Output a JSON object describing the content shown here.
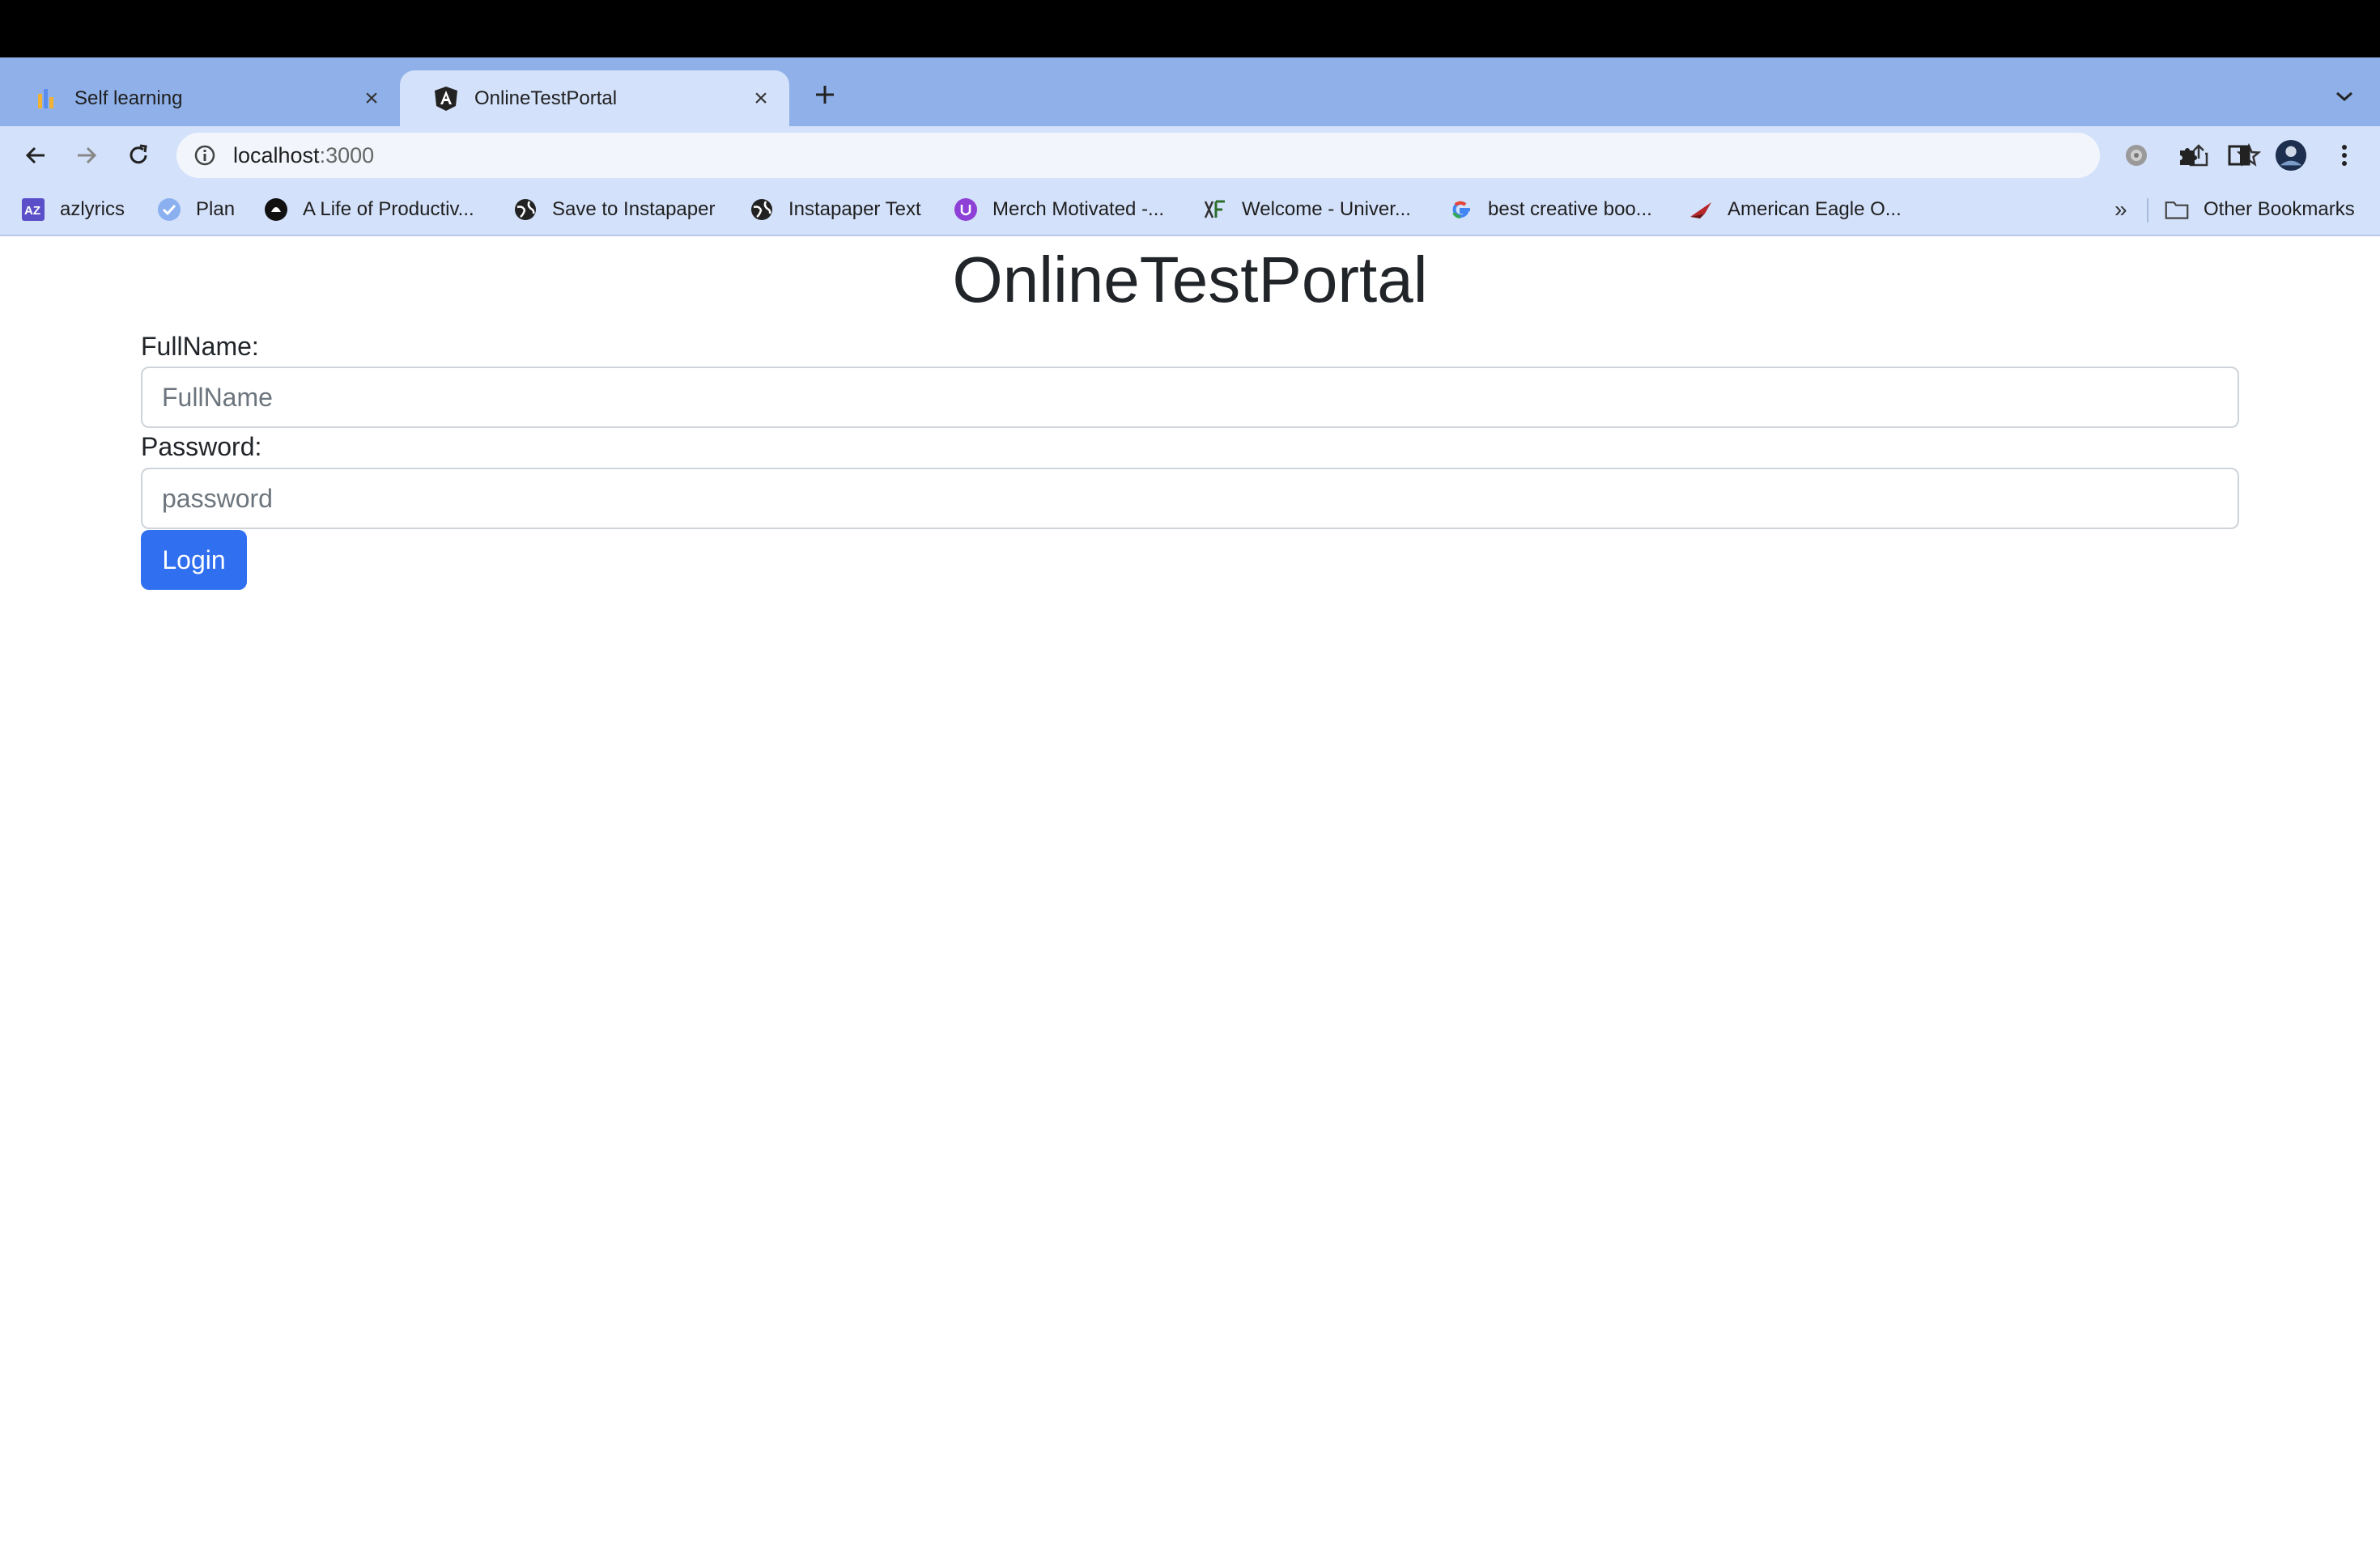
{
  "browser": {
    "tabs": [
      {
        "title": "Self learning",
        "active": false,
        "icon": "bar-chart-icon"
      },
      {
        "title": "OnlineTestPortal",
        "active": true,
        "icon": "angular-icon"
      }
    ],
    "url": {
      "host": "localhost",
      "port": ":3000"
    },
    "bookmarks": [
      {
        "label": "azlyrics",
        "icon": "azlyrics-icon"
      },
      {
        "label": "Plan",
        "icon": "check-circle-icon"
      },
      {
        "label": "A Life of Productiv...",
        "icon": "productivity-icon"
      },
      {
        "label": "Save to Instapaper",
        "icon": "globe-icon"
      },
      {
        "label": "Instapaper Text",
        "icon": "globe-icon"
      },
      {
        "label": "Merch Motivated -...",
        "icon": "merch-icon"
      },
      {
        "label": "Welcome - Univer...",
        "icon": "university-icon"
      },
      {
        "label": "best creative boo...",
        "icon": "google-icon"
      },
      {
        "label": "American Eagle O...",
        "icon": "eagle-icon"
      }
    ],
    "more_bookmarks": "»",
    "other_bookmarks": "Other Bookmarks"
  },
  "page": {
    "title": "OnlineTestPortal",
    "fullname_label": "FullName:",
    "fullname_placeholder": "FullName",
    "password_label": "Password:",
    "password_placeholder": "password",
    "login_label": "Login"
  },
  "colors": {
    "accent": "#2f6ff0",
    "tabstrip": "#8fb0e8",
    "toolbar": "#d3e1fa"
  }
}
